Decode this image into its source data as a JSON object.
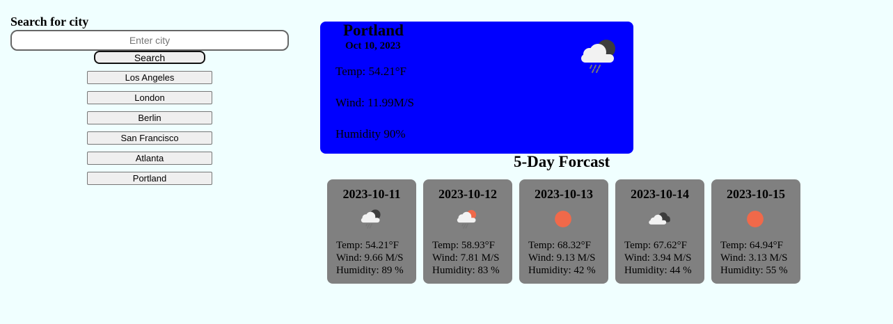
{
  "search": {
    "heading": "Search for city",
    "placeholder": "Enter city",
    "button_label": "Search"
  },
  "history": [
    {
      "label": "Los Angeles"
    },
    {
      "label": "London"
    },
    {
      "label": "Berlin"
    },
    {
      "label": "San Francisco"
    },
    {
      "label": "Atlanta"
    },
    {
      "label": "Portland"
    }
  ],
  "current": {
    "city": "Portland",
    "date": "Oct 10, 2023",
    "temp": "Temp: 54.21°F",
    "wind": "Wind: 11.99M/S",
    "humidity": "Humidity 90%",
    "icon": "rain-cloud-night-icon"
  },
  "forecast": {
    "heading": "5-Day Forcast",
    "days": [
      {
        "date": "2023-10-11",
        "icon": "rain-cloud-night-icon",
        "temp": "Temp: 54.21°F",
        "wind": "Wind: 9.66 M/S",
        "humidity": "Humidity: 89 %"
      },
      {
        "date": "2023-10-12",
        "icon": "rain-cloud-sun-icon",
        "temp": "Temp: 58.93°F",
        "wind": "Wind: 7.81 M/S",
        "humidity": "Humidity: 83 %"
      },
      {
        "date": "2023-10-13",
        "icon": "sun-icon",
        "temp": "Temp: 68.32°F",
        "wind": "Wind: 9.13 M/S",
        "humidity": "Humidity: 42 %"
      },
      {
        "date": "2023-10-14",
        "icon": "broken-clouds-icon",
        "temp": "Temp: 67.62°F",
        "wind": "Wind: 3.94 M/S",
        "humidity": "Humidity: 44 %"
      },
      {
        "date": "2023-10-15",
        "icon": "sun-icon",
        "temp": "Temp: 64.94°F",
        "wind": "Wind: 3.13 M/S",
        "humidity": "Humidity: 55 %"
      }
    ]
  },
  "colors": {
    "page_background": "#f0ffff",
    "current_card": "#0000ff",
    "forecast_card": "#808080",
    "sun": "#f0694a"
  }
}
